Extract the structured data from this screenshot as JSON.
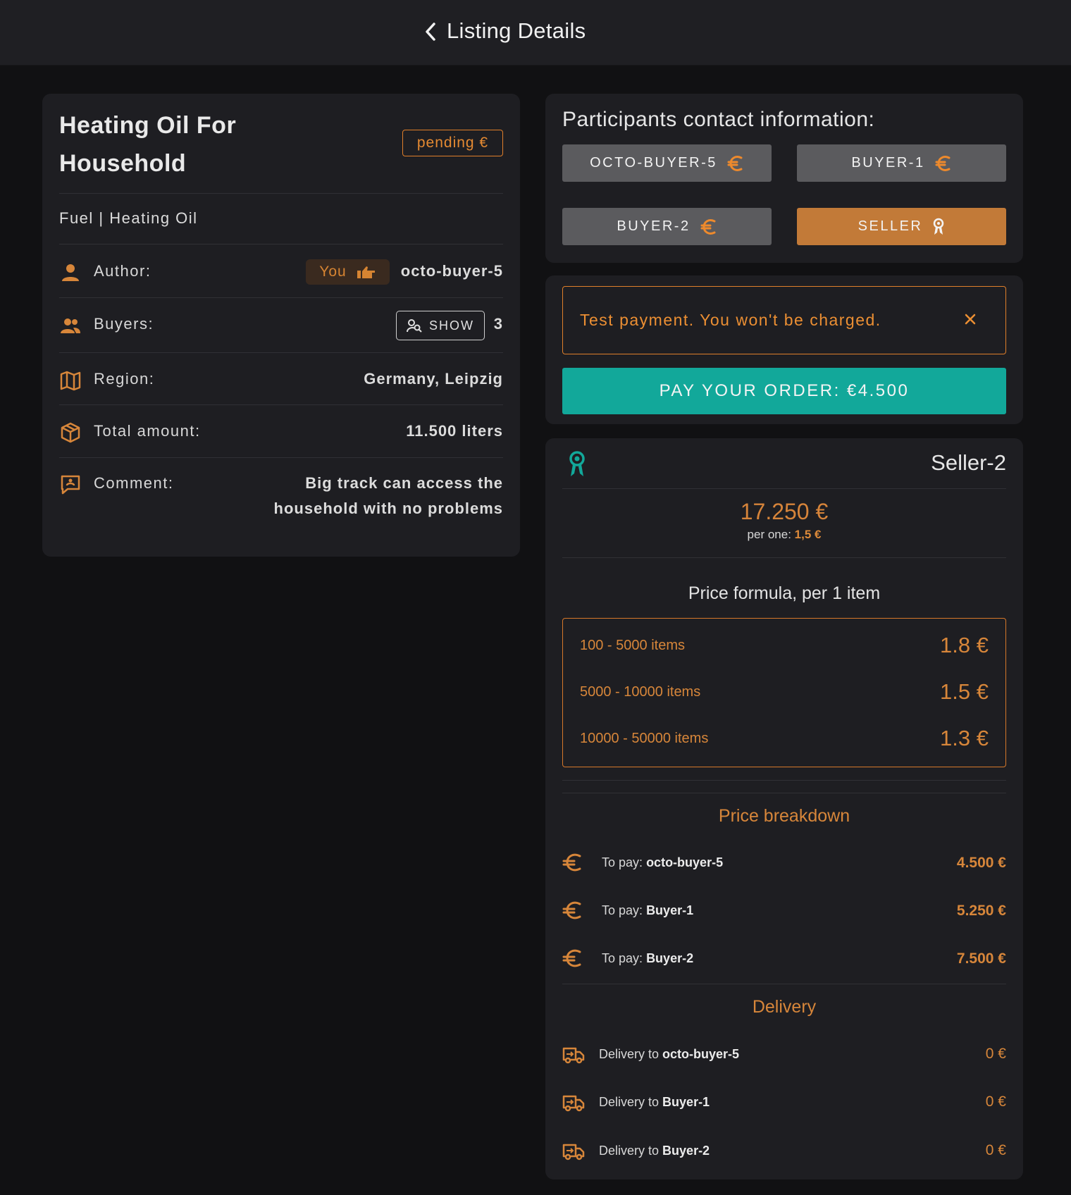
{
  "header": {
    "title": "Listing Details",
    "back_icon": "chevron-left-icon"
  },
  "listing": {
    "title": "Heating Oil For Household",
    "status": "pending €",
    "category": "Fuel | Heating Oil",
    "author": {
      "label": "Author:",
      "you_chip": "You",
      "value": "octo-buyer-5"
    },
    "buyers": {
      "label": "Buyers:",
      "show_label": "SHOW",
      "count": "3"
    },
    "region": {
      "label": "Region:",
      "value": "Germany, Leipzig"
    },
    "total_amount": {
      "label": "Total amount:",
      "value": "11.500 liters"
    },
    "comment": {
      "label": "Comment:",
      "value": "Big track can access the household with no problems"
    }
  },
  "participants": {
    "title": "Participants contact information:",
    "buttons": [
      {
        "label": "OCTO-BUYER-5",
        "icon": "euro-icon"
      },
      {
        "label": "BUYER-1",
        "icon": "euro-icon"
      },
      {
        "label": "BUYER-2",
        "icon": "euro-icon"
      },
      {
        "label": "SELLER",
        "icon": "award-icon"
      }
    ]
  },
  "payment": {
    "alert": "Test payment. You won't be charged.",
    "pay_button": "PAY YOUR ORDER: €4.500"
  },
  "seller": {
    "name": "Seller-2",
    "total": "17.250 €",
    "per_one_label": "per one:",
    "per_one_value": "1,5 €",
    "formula_title": "Price formula, per 1 item",
    "formula": [
      {
        "range": "100 - 5000 items",
        "price": "1.8 €"
      },
      {
        "range": "5000 - 10000 items",
        "price": "1.5 €"
      },
      {
        "range": "10000 - 50000 items",
        "price": "1.3 €"
      }
    ],
    "breakdown_title": "Price breakdown",
    "breakdown": [
      {
        "prefix": "To pay:",
        "name": "octo-buyer-5",
        "amount": "4.500 €"
      },
      {
        "prefix": "To pay:",
        "name": "Buyer-1",
        "amount": "5.250 €"
      },
      {
        "prefix": "To pay:",
        "name": "Buyer-2",
        "amount": "7.500 €"
      }
    ],
    "delivery_title": "Delivery",
    "delivery": [
      {
        "prefix": "Delivery to",
        "name": "octo-buyer-5",
        "amount": "0 €"
      },
      {
        "prefix": "Delivery to",
        "name": "Buyer-1",
        "amount": "0 €"
      },
      {
        "prefix": "Delivery to",
        "name": "Buyer-2",
        "amount": "0 €"
      }
    ]
  },
  "colors": {
    "accent": "#d7863a",
    "teal": "#12a89a",
    "background": "#111113",
    "card": "#1e1e22"
  }
}
